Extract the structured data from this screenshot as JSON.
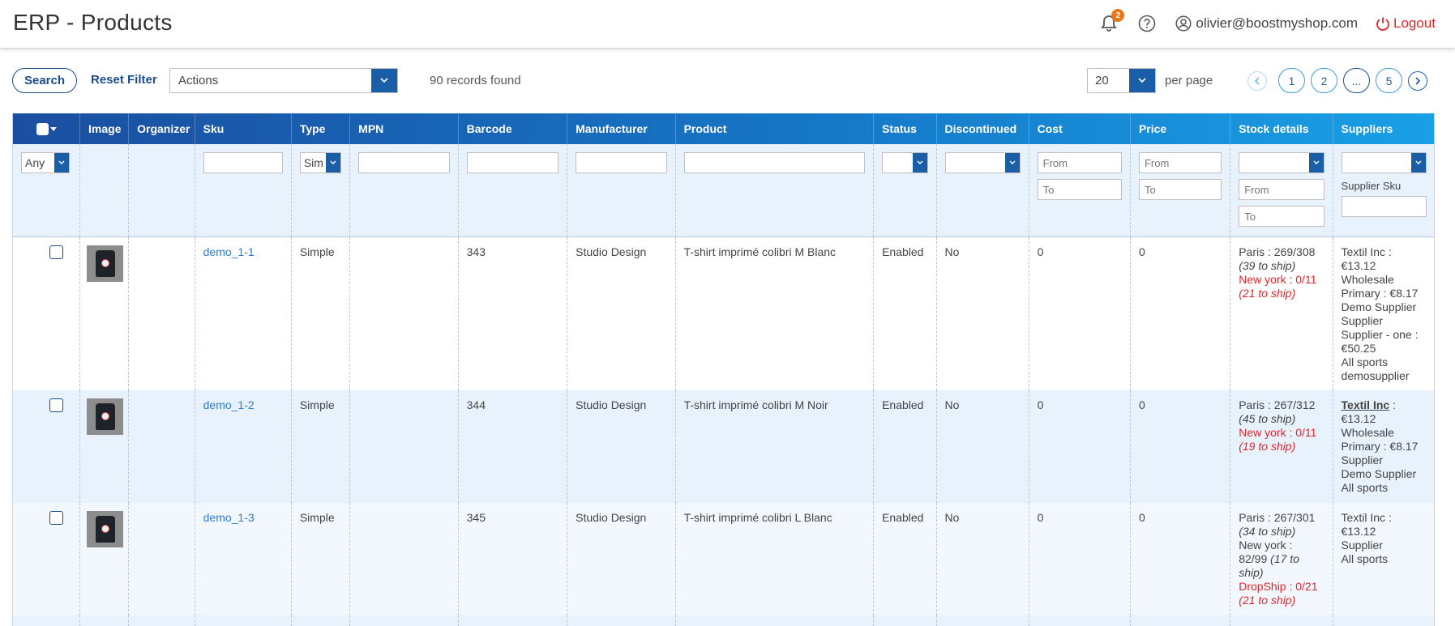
{
  "header": {
    "title": "ERP - Products",
    "notifications_count": "2",
    "user_email": "olivier@boostmyshop.com",
    "logout_label": "Logout"
  },
  "toolbar": {
    "search_label": "Search",
    "reset_label": "Reset Filter",
    "actions_value": "Actions",
    "records_text": "90 records found",
    "per_page_value": "20",
    "per_page_label": "per page",
    "pages": [
      "1",
      "2",
      "...",
      "5"
    ]
  },
  "grid": {
    "columns": [
      "Image",
      "Organizer",
      "Sku",
      "Type",
      "MPN",
      "Barcode",
      "Manufacturer",
      "Product",
      "Status",
      "Discontinued",
      "Cost",
      "Price",
      "Stock details",
      "Suppliers"
    ],
    "filters": {
      "checkbox_any": "Any",
      "type_value": "Sim",
      "from_placeholder": "From",
      "to_placeholder": "To",
      "supplier_sku_label": "Supplier Sku"
    },
    "rows": [
      {
        "sku": "demo_1-1",
        "type": "Simple",
        "mpn": "",
        "barcode": "343",
        "manufacturer": "Studio Design",
        "product": "T-shirt imprimé colibri M Blanc",
        "status": "Enabled",
        "discontinued": "No",
        "cost": "0",
        "price": "0",
        "stock": [
          {
            "line": "Paris : 269/308",
            "ship": "(39 to ship)",
            "red": false
          },
          {
            "line": "New york : 0/11",
            "ship": "(21 to ship)",
            "red": true
          }
        ],
        "suppliers": [
          "Textil Inc :",
          "€13.12",
          "Wholesale",
          "Primary : €8.17",
          "Demo Supplier",
          "Supplier",
          "Supplier - one :",
          "€50.25",
          "All sports",
          "demosupplier"
        ]
      },
      {
        "sku": "demo_1-2",
        "type": "Simple",
        "mpn": "",
        "barcode": "344",
        "manufacturer": "Studio Design",
        "product": "T-shirt imprimé colibri M Noir",
        "status": "Enabled",
        "discontinued": "No",
        "cost": "0",
        "price": "0",
        "stock": [
          {
            "line": "Paris : 267/312",
            "ship": "(45 to ship)",
            "red": false
          },
          {
            "line": "New york : 0/11",
            "ship": "(19 to ship)",
            "red": true
          }
        ],
        "suppliers_first_bold": "Textil Inc",
        "suppliers_first_rest": " :",
        "suppliers": [
          "€13.12",
          "Wholesale",
          "Primary : €8.17",
          "Supplier",
          "Demo Supplier",
          "All sports"
        ]
      },
      {
        "sku": "demo_1-3",
        "type": "Simple",
        "mpn": "",
        "barcode": "345",
        "manufacturer": "Studio Design",
        "product": "T-shirt imprimé colibri L Blanc",
        "status": "Enabled",
        "discontinued": "No",
        "cost": "0",
        "price": "0",
        "stock_lines": {
          "paris": "Paris : 267/301",
          "paris_ship": "(34 to ship)",
          "ny_1": "New york :",
          "ny_2": "82/99",
          "ny_ship_1": "(17 to",
          "ny_ship_2": "ship)",
          "drop": "DropShip : 0/21",
          "drop_ship": "(21 to ship)"
        },
        "suppliers": [
          "Textil Inc :",
          "€13.12",
          "Supplier",
          "All sports"
        ]
      }
    ]
  },
  "colors": {
    "brand_blue": "#1b4e8c",
    "link_blue": "#2a7bd3",
    "alert_red": "#e0262a",
    "badge_orange": "#e8761b"
  }
}
